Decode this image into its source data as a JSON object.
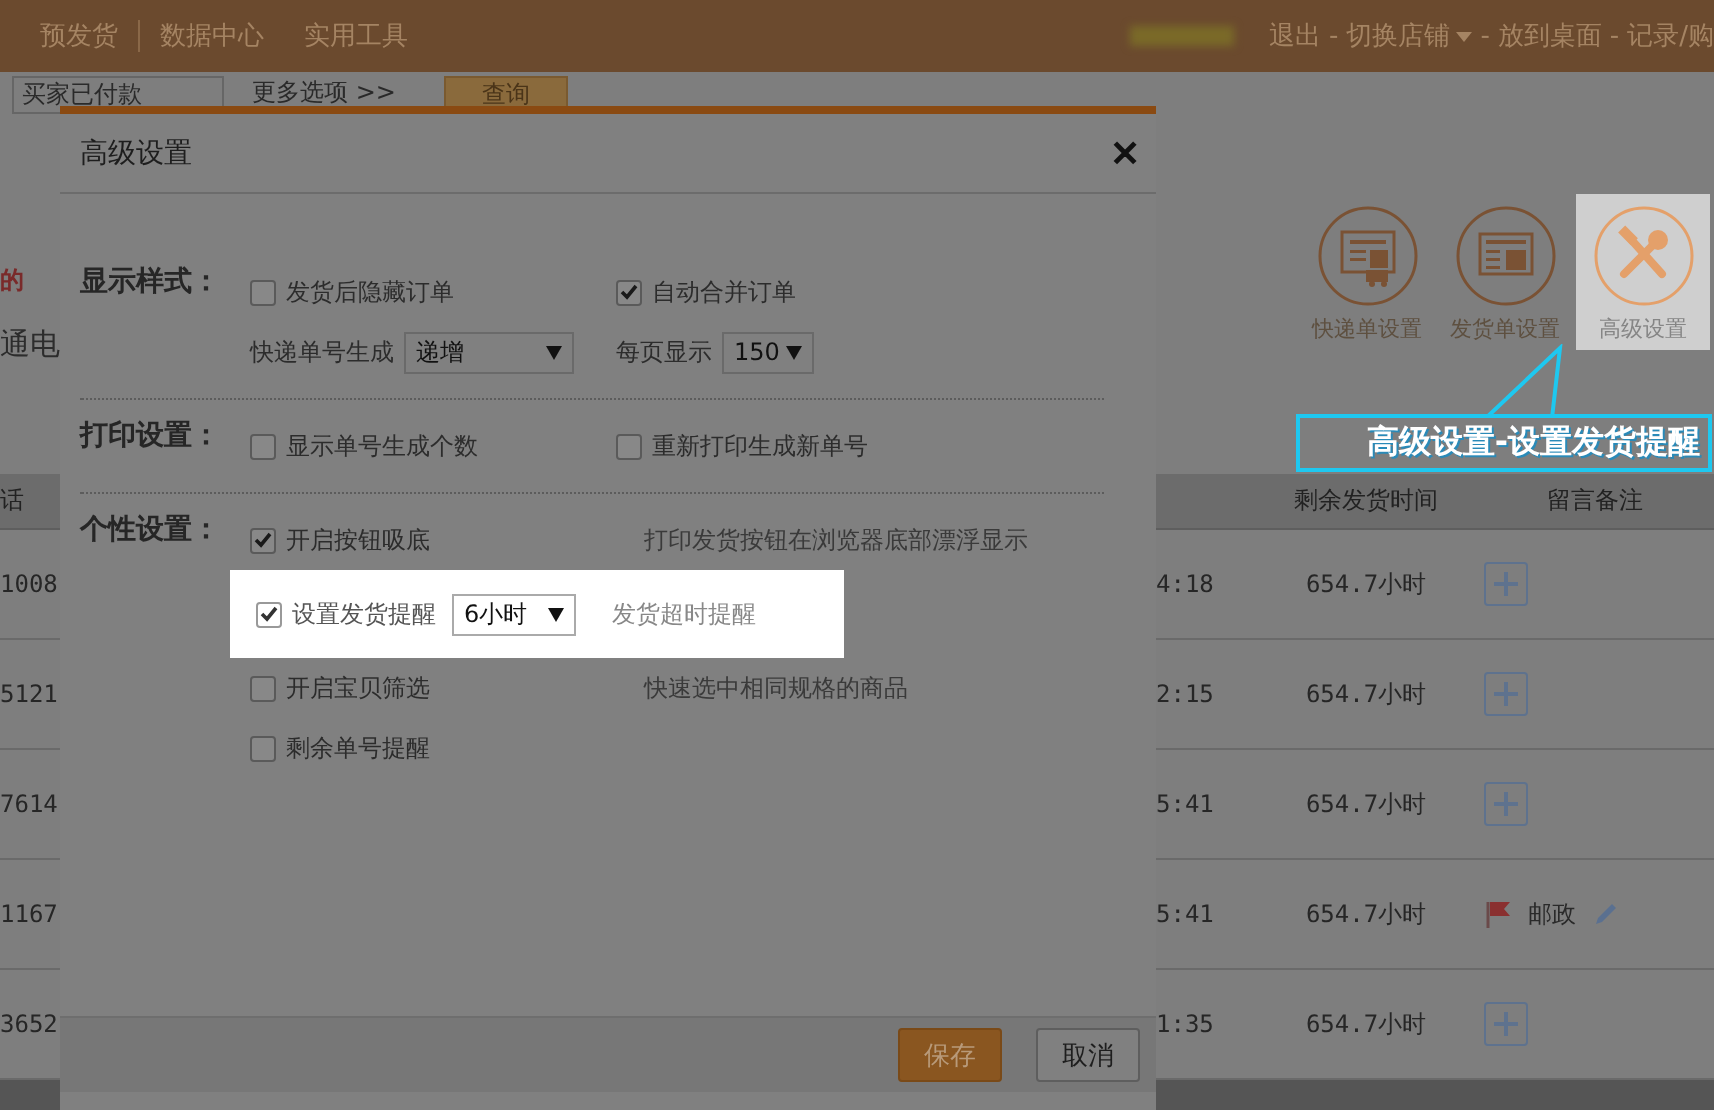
{
  "top_nav": {
    "items": [
      "预发货",
      "数据中心",
      "实用工具"
    ],
    "separator": "-",
    "links": [
      {
        "label": "退出",
        "dropdown": false
      },
      {
        "label": "切换店铺",
        "dropdown": true
      },
      {
        "label": "放到桌面",
        "dropdown": false
      },
      {
        "label": "记录/购",
        "dropdown": false
      }
    ]
  },
  "filter_bar": {
    "status_select": "买家已付款",
    "more_options": "更多选项 >>",
    "query_button": "查询"
  },
  "side_fragments": [
    {
      "text": "的",
      "kind": "warning"
    },
    {
      "text": "通电",
      "kind": "heading"
    }
  ],
  "tools": [
    {
      "label": "快递单设置",
      "highlighted": false
    },
    {
      "label": "发货单设置",
      "highlighted": false
    },
    {
      "label": "高级设置",
      "highlighted": true
    }
  ],
  "callout": {
    "text": "高级设置-设置发货提醒"
  },
  "table": {
    "columns": {
      "column_1": "话",
      "column_2": "剩余发货时间",
      "column_3": "留言备注"
    },
    "rows": [
      {
        "id_tail": "1008",
        "time_tail": "4:18",
        "remaining": "654.7小时",
        "note": {
          "kind": "add"
        }
      },
      {
        "id_tail": "5121",
        "time_tail": "2:15",
        "remaining": "654.7小时",
        "note": {
          "kind": "add"
        }
      },
      {
        "id_tail": "7614",
        "time_tail": "5:41",
        "remaining": "654.7小时",
        "note": {
          "kind": "add"
        }
      },
      {
        "id_tail": "1167",
        "time_tail": "5:41",
        "remaining": "654.7小时",
        "note": {
          "kind": "flag",
          "label": "邮政"
        }
      },
      {
        "id_tail": "3652",
        "time_tail": "1:35",
        "remaining": "654.7小时",
        "note": {
          "kind": "add"
        }
      }
    ]
  },
  "dialog": {
    "title": "高级设置",
    "close": "✕",
    "sections": [
      {
        "label": "显示样式：",
        "rows": [
          {
            "highlighted": false,
            "items": [
              {
                "kind": "checkbox",
                "label": "发货后隐藏订单",
                "checked": false
              },
              {
                "kind": "checkbox",
                "label": "自动合并订单",
                "checked": true
              }
            ]
          },
          {
            "highlighted": false,
            "items": [
              {
                "kind": "select",
                "label": "快递单号生成",
                "value": "递增",
                "wide": true
              },
              {
                "kind": "select",
                "label": "每页显示",
                "value": "150",
                "wide": false
              }
            ]
          }
        ]
      },
      {
        "label": "打印设置：",
        "rows": [
          {
            "highlighted": false,
            "items": [
              {
                "kind": "checkbox",
                "label": "显示单号生成个数",
                "checked": false
              },
              {
                "kind": "checkbox",
                "label": "重新打印生成新单号",
                "checked": false
              }
            ]
          }
        ]
      },
      {
        "label": "个性设置：",
        "rows": [
          {
            "highlighted": false,
            "items": [
              {
                "kind": "checkbox",
                "label": "开启按钮吸底",
                "checked": true
              },
              {
                "kind": "note",
                "text": "打印发货按钮在浏览器底部漂浮显示"
              }
            ]
          },
          {
            "highlighted": true,
            "items": [
              {
                "kind": "checkbox",
                "label": "设置发货提醒",
                "checked": true
              },
              {
                "kind": "select",
                "value": "6小时"
              },
              {
                "kind": "note",
                "text": "发货超时提醒"
              }
            ]
          },
          {
            "highlighted": false,
            "items": [
              {
                "kind": "checkbox",
                "label": "开启宝贝筛选",
                "checked": false
              },
              {
                "kind": "note",
                "text": "快速选中相同规格的商品"
              }
            ]
          },
          {
            "highlighted": false,
            "items": [
              {
                "kind": "checkbox",
                "label": "剩余单号提醒",
                "checked": false
              }
            ]
          }
        ]
      }
    ],
    "buttons": [
      {
        "label": "保存",
        "kind": "primary"
      },
      {
        "label": "取消",
        "kind": "default"
      }
    ]
  }
}
